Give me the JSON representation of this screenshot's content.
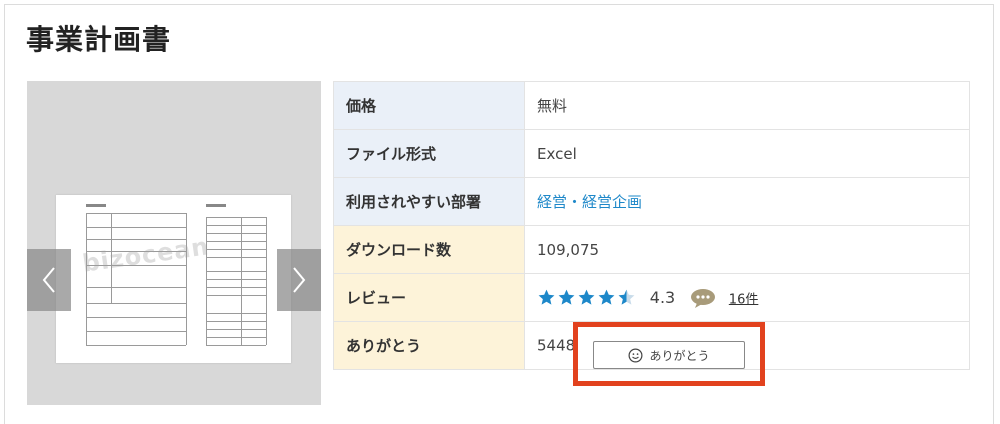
{
  "page": {
    "title": "事業計画書"
  },
  "preview": {
    "watermark": "bizocean",
    "prev_label": "‹",
    "next_label": "›"
  },
  "info": {
    "rows": [
      {
        "label": "価格",
        "value": "無料"
      },
      {
        "label": "ファイル形式",
        "value": "Excel"
      },
      {
        "label": "利用されやすい部署",
        "value": "経営・経営企画"
      },
      {
        "label": "ダウンロード数",
        "value": "109,075"
      },
      {
        "label": "レビュー",
        "rating": "4.3",
        "rating_value": 4.3,
        "review_count": "16件"
      },
      {
        "label": "ありがとう",
        "count": "5448",
        "button_label": "ありがとう"
      }
    ]
  },
  "colors": {
    "label_blue": "#eaf0f8",
    "label_yellow": "#fdf3d9",
    "link": "#1e88c9",
    "star": "#1e88c9",
    "highlight": "#e2421e"
  }
}
